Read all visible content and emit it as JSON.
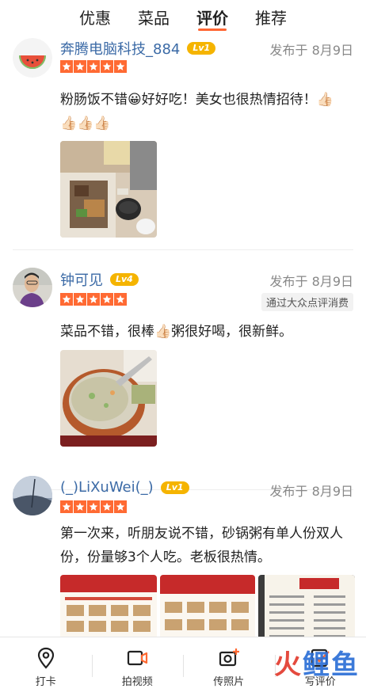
{
  "tabs": [
    "优惠",
    "菜品",
    "评价",
    "推荐"
  ],
  "active_tab": "评价",
  "reviews": [
    {
      "user": "奔腾电脑科技_884",
      "level": "Lv1",
      "date": "发布于 8月9日",
      "rating": 5,
      "text": "粉肠饭不错😀好好吃！美女也很热情招待！👍🏻👍🏻👍🏻👍🏻",
      "badge": ""
    },
    {
      "user": "钟可见",
      "level": "Lv4",
      "date": "发布于 8月9日",
      "rating": 5,
      "text": "菜品不错，很棒👍🏻粥很好喝，很新鲜。",
      "badge": "通过大众点评消费"
    },
    {
      "user": "(_)LiXuWei(_)",
      "level": "Lv1",
      "date": "发布于 8月9日",
      "rating": 5,
      "text": "第一次来，听朋友说不错，砂锅粥有单人份双人份，份量够3个人吃。老板很热情。",
      "badge": ""
    }
  ],
  "bottom_bar": [
    {
      "label": "打卡",
      "icon": "location-pin-icon"
    },
    {
      "label": "拍视频",
      "icon": "video-camera-icon"
    },
    {
      "label": "传照片",
      "icon": "photo-upload-icon"
    },
    {
      "label": "写评价",
      "icon": "write-review-icon"
    }
  ],
  "watermark": {
    "red": "火",
    "blue": "鲤",
    "red2": "鱼"
  },
  "colors": {
    "accent": "#ff6a33",
    "username": "#3b6aa6",
    "level_badge": "#f5b400"
  }
}
